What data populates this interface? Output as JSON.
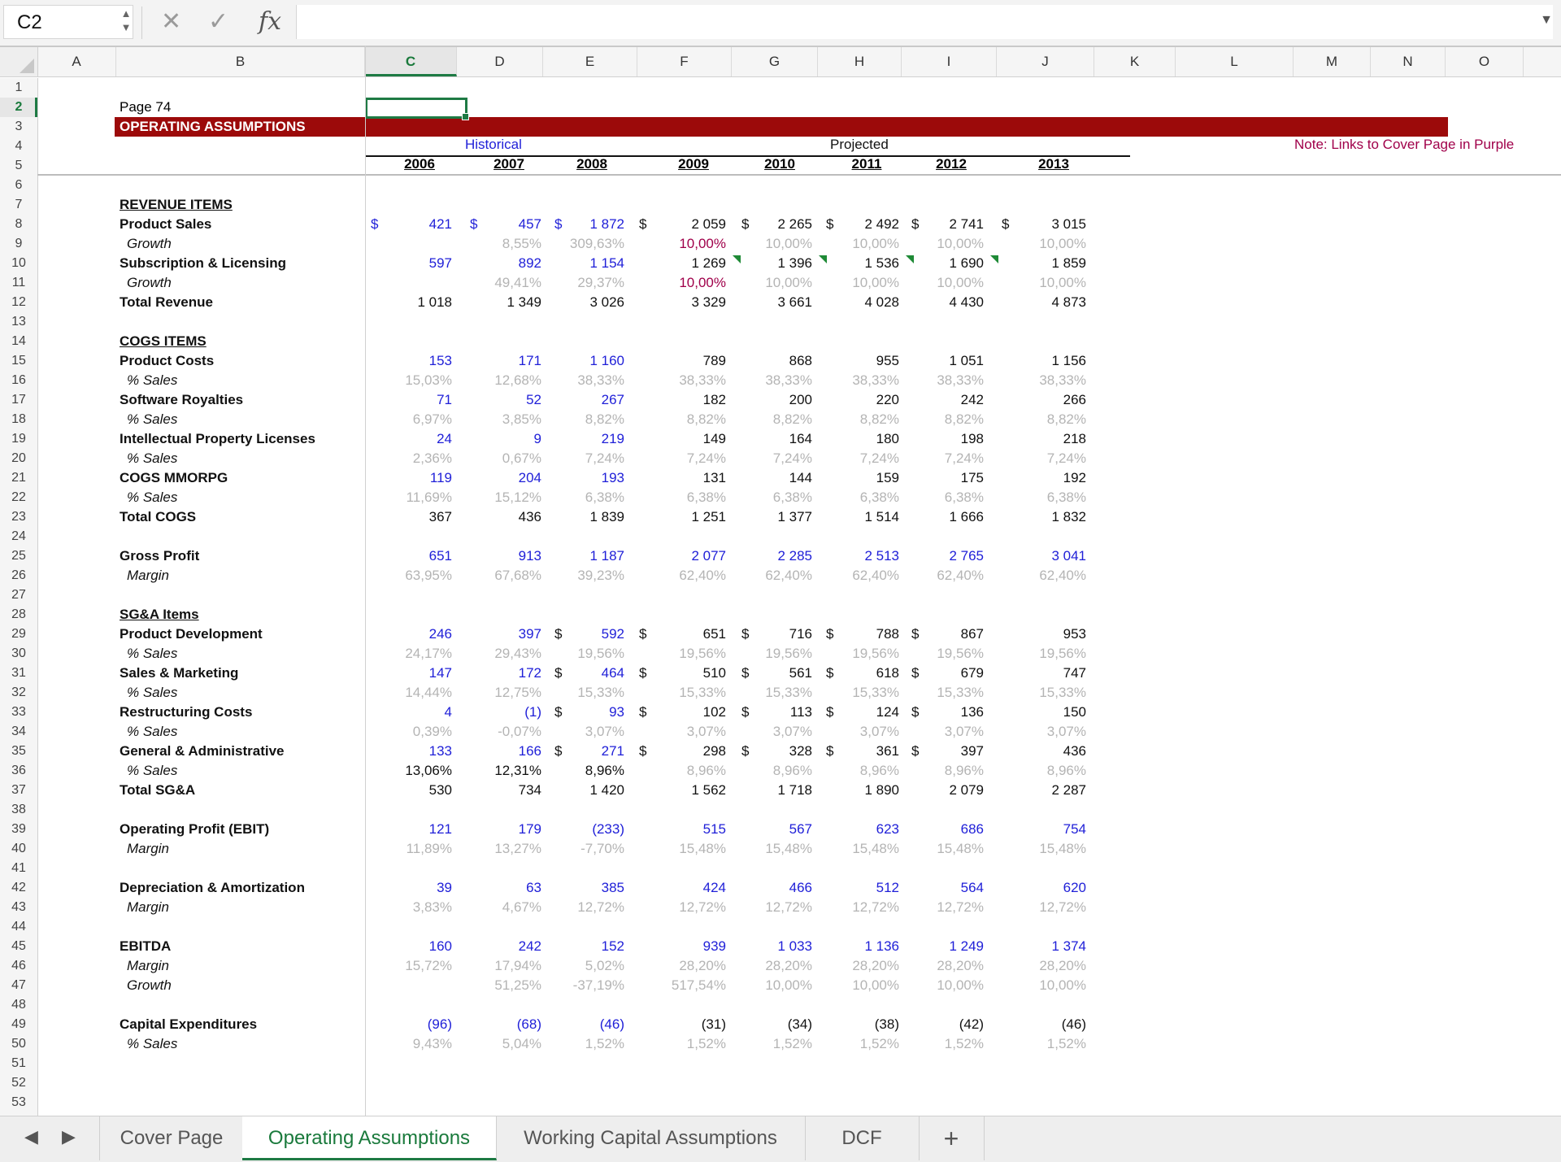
{
  "formula_bar": {
    "name_box": "C2",
    "fx": "fx"
  },
  "columns": [
    "A",
    "B",
    "C",
    "D",
    "E",
    "F",
    "G",
    "H",
    "I",
    "J",
    "K",
    "L",
    "M",
    "N",
    "O"
  ],
  "rows": [
    "1",
    "2",
    "3",
    "4",
    "5",
    "6",
    "7",
    "8",
    "9",
    "10",
    "11",
    "12",
    "13",
    "14",
    "15",
    "16",
    "17",
    "18",
    "19",
    "20",
    "21",
    "22",
    "23",
    "24",
    "25",
    "26",
    "27",
    "28",
    "29",
    "30",
    "31",
    "32",
    "33",
    "34",
    "35",
    "36",
    "37",
    "38",
    "39",
    "40",
    "41",
    "42",
    "43",
    "44",
    "45",
    "46",
    "47",
    "48",
    "49",
    "50",
    "51",
    "52",
    "53"
  ],
  "sheet": {
    "page_label": "Page 74",
    "title": "OPERATING ASSUMPTIONS",
    "historical": "Historical",
    "projected": "Projected",
    "years": [
      "2006",
      "2007",
      "2008",
      "2009",
      "2010",
      "2011",
      "2012",
      "2013"
    ],
    "note": "Note: Links to Cover Page in Purple",
    "dollar": "$",
    "lines": [
      {
        "row": 7,
        "label": "REVENUE ITEMS",
        "style": "bu"
      },
      {
        "row": 8,
        "label": "Product Sales",
        "style": "b",
        "values": [
          "421",
          "457",
          "1 872",
          "2 059",
          "2 265",
          "2 492",
          "2 741",
          "3 015"
        ],
        "colors": [
          "blue",
          "blue",
          "blue",
          "black",
          "black",
          "black",
          "black",
          "black"
        ],
        "dollars": [
          true,
          true,
          true,
          true,
          true,
          true,
          true,
          true
        ]
      },
      {
        "row": 9,
        "label": "Growth",
        "style": "i",
        "values": [
          "",
          "8,55%",
          "309,63%",
          "10,00%",
          "10,00%",
          "10,00%",
          "10,00%",
          "10,00%"
        ],
        "colors": [
          "grey",
          "grey",
          "grey",
          "purple",
          "grey",
          "grey",
          "grey",
          "grey"
        ]
      },
      {
        "row": 10,
        "label": "Subscription & Licensing",
        "style": "b",
        "values": [
          "597",
          "892",
          "1 154",
          "1 269",
          "1 396",
          "1 536",
          "1 690",
          "1 859"
        ],
        "colors": [
          "blue",
          "blue",
          "blue",
          "black",
          "black",
          "black",
          "black",
          "black"
        ],
        "marks": [
          false,
          false,
          false,
          true,
          true,
          true,
          true,
          false
        ]
      },
      {
        "row": 11,
        "label": "Growth",
        "style": "i",
        "values": [
          "",
          "49,41%",
          "29,37%",
          "10,00%",
          "10,00%",
          "10,00%",
          "10,00%",
          "10,00%"
        ],
        "colors": [
          "grey",
          "grey",
          "grey",
          "purple",
          "grey",
          "grey",
          "grey",
          "grey"
        ]
      },
      {
        "row": 12,
        "label": "Total Revenue",
        "style": "b",
        "values": [
          "1 018",
          "1 349",
          "3 026",
          "3 329",
          "3 661",
          "4 028",
          "4 430",
          "4 873"
        ],
        "colors": [
          "black",
          "black",
          "black",
          "black",
          "black",
          "black",
          "black",
          "black"
        ]
      },
      {
        "row": 14,
        "label": "COGS ITEMS",
        "style": "bu"
      },
      {
        "row": 15,
        "label": "Product Costs",
        "style": "b",
        "values": [
          "153",
          "171",
          "1 160",
          "789",
          "868",
          "955",
          "1 051",
          "1 156"
        ],
        "colors": [
          "blue",
          "blue",
          "blue",
          "black",
          "black",
          "black",
          "black",
          "black"
        ]
      },
      {
        "row": 16,
        "label": "% Sales",
        "style": "i",
        "values": [
          "15,03%",
          "12,68%",
          "38,33%",
          "38,33%",
          "38,33%",
          "38,33%",
          "38,33%",
          "38,33%"
        ],
        "colors": [
          "grey",
          "grey",
          "grey",
          "grey",
          "grey",
          "grey",
          "grey",
          "grey"
        ]
      },
      {
        "row": 17,
        "label": "Software Royalties",
        "style": "b",
        "values": [
          "71",
          "52",
          "267",
          "182",
          "200",
          "220",
          "242",
          "266"
        ],
        "colors": [
          "blue",
          "blue",
          "blue",
          "black",
          "black",
          "black",
          "black",
          "black"
        ]
      },
      {
        "row": 18,
        "label": "% Sales",
        "style": "i",
        "values": [
          "6,97%",
          "3,85%",
          "8,82%",
          "8,82%",
          "8,82%",
          "8,82%",
          "8,82%",
          "8,82%"
        ],
        "colors": [
          "grey",
          "grey",
          "grey",
          "grey",
          "grey",
          "grey",
          "grey",
          "grey"
        ]
      },
      {
        "row": 19,
        "label": "Intellectual Property Licenses",
        "style": "b",
        "values": [
          "24",
          "9",
          "219",
          "149",
          "164",
          "180",
          "198",
          "218"
        ],
        "colors": [
          "blue",
          "blue",
          "blue",
          "black",
          "black",
          "black",
          "black",
          "black"
        ]
      },
      {
        "row": 20,
        "label": "% Sales",
        "style": "i",
        "values": [
          "2,36%",
          "0,67%",
          "7,24%",
          "7,24%",
          "7,24%",
          "7,24%",
          "7,24%",
          "7,24%"
        ],
        "colors": [
          "grey",
          "grey",
          "grey",
          "grey",
          "grey",
          "grey",
          "grey",
          "grey"
        ]
      },
      {
        "row": 21,
        "label": "COGS MMORPG",
        "style": "b",
        "values": [
          "119",
          "204",
          "193",
          "131",
          "144",
          "159",
          "175",
          "192"
        ],
        "colors": [
          "blue",
          "blue",
          "blue",
          "black",
          "black",
          "black",
          "black",
          "black"
        ]
      },
      {
        "row": 22,
        "label": "% Sales",
        "style": "i",
        "values": [
          "11,69%",
          "15,12%",
          "6,38%",
          "6,38%",
          "6,38%",
          "6,38%",
          "6,38%",
          "6,38%"
        ],
        "colors": [
          "grey",
          "grey",
          "grey",
          "grey",
          "grey",
          "grey",
          "grey",
          "grey"
        ]
      },
      {
        "row": 23,
        "label": "Total COGS",
        "style": "b",
        "values": [
          "367",
          "436",
          "1 839",
          "1 251",
          "1 377",
          "1 514",
          "1 666",
          "1 832"
        ],
        "colors": [
          "black",
          "black",
          "black",
          "black",
          "black",
          "black",
          "black",
          "black"
        ]
      },
      {
        "row": 25,
        "label": "Gross Profit",
        "style": "b",
        "values": [
          "651",
          "913",
          "1 187",
          "2 077",
          "2 285",
          "2 513",
          "2 765",
          "3 041"
        ],
        "colors": [
          "blue",
          "blue",
          "blue",
          "blue",
          "blue",
          "blue",
          "blue",
          "blue"
        ]
      },
      {
        "row": 26,
        "label": "Margin",
        "style": "i",
        "values": [
          "63,95%",
          "67,68%",
          "39,23%",
          "62,40%",
          "62,40%",
          "62,40%",
          "62,40%",
          "62,40%"
        ],
        "colors": [
          "grey",
          "grey",
          "grey",
          "grey",
          "grey",
          "grey",
          "grey",
          "grey"
        ]
      },
      {
        "row": 28,
        "label": " SG&A Items",
        "style": "bu"
      },
      {
        "row": 29,
        "label": "Product Development",
        "style": "b",
        "values": [
          "246",
          "397",
          "592",
          "651",
          "716",
          "788",
          "867",
          "953"
        ],
        "colors": [
          "blue",
          "blue",
          "blue",
          "black",
          "black",
          "black",
          "black",
          "black"
        ],
        "dollars": [
          false,
          false,
          true,
          true,
          true,
          true,
          true,
          false
        ]
      },
      {
        "row": 30,
        "label": "% Sales",
        "style": "i",
        "values": [
          "24,17%",
          "29,43%",
          "19,56%",
          "19,56%",
          "19,56%",
          "19,56%",
          "19,56%",
          "19,56%"
        ],
        "colors": [
          "grey",
          "grey",
          "grey",
          "grey",
          "grey",
          "grey",
          "grey",
          "grey"
        ]
      },
      {
        "row": 31,
        "label": "Sales & Marketing",
        "style": "b",
        "values": [
          "147",
          "172",
          "464",
          "510",
          "561",
          "618",
          "679",
          "747"
        ],
        "colors": [
          "blue",
          "blue",
          "blue",
          "black",
          "black",
          "black",
          "black",
          "black"
        ],
        "dollars": [
          false,
          false,
          true,
          true,
          true,
          true,
          true,
          false
        ]
      },
      {
        "row": 32,
        "label": "% Sales",
        "style": "i",
        "values": [
          "14,44%",
          "12,75%",
          "15,33%",
          "15,33%",
          "15,33%",
          "15,33%",
          "15,33%",
          "15,33%"
        ],
        "colors": [
          "grey",
          "grey",
          "grey",
          "grey",
          "grey",
          "grey",
          "grey",
          "grey"
        ]
      },
      {
        "row": 33,
        "label": "Restructuring Costs",
        "style": "b",
        "values": [
          "4",
          "(1)",
          "93",
          "102",
          "113",
          "124",
          "136",
          "150"
        ],
        "colors": [
          "blue",
          "blue",
          "blue",
          "black",
          "black",
          "black",
          "black",
          "black"
        ],
        "dollars": [
          false,
          false,
          true,
          true,
          true,
          true,
          true,
          false
        ]
      },
      {
        "row": 34,
        "label": "% Sales",
        "style": "i",
        "values": [
          "0,39%",
          "-0,07%",
          "3,07%",
          "3,07%",
          "3,07%",
          "3,07%",
          "3,07%",
          "3,07%"
        ],
        "colors": [
          "grey",
          "grey",
          "grey",
          "grey",
          "grey",
          "grey",
          "grey",
          "grey"
        ]
      },
      {
        "row": 35,
        "label": "General & Administrative",
        "style": "b",
        "values": [
          "133",
          "166",
          "271",
          "298",
          "328",
          "361",
          "397",
          "436"
        ],
        "colors": [
          "blue",
          "blue",
          "blue",
          "black",
          "black",
          "black",
          "black",
          "black"
        ],
        "dollars": [
          false,
          false,
          true,
          true,
          true,
          true,
          true,
          false
        ]
      },
      {
        "row": 36,
        "label": "% Sales",
        "style": "i",
        "values": [
          "13,06%",
          "12,31%",
          "8,96%",
          "8,96%",
          "8,96%",
          "8,96%",
          "8,96%",
          "8,96%"
        ],
        "colors": [
          "black",
          "black",
          "black",
          "grey",
          "grey",
          "grey",
          "grey",
          "grey"
        ]
      },
      {
        "row": 37,
        "label": "Total SG&A",
        "style": "b",
        "values": [
          "530",
          "734",
          "1 420",
          "1 562",
          "1 718",
          "1 890",
          "2 079",
          "2 287"
        ],
        "colors": [
          "black",
          "black",
          "black",
          "black",
          "black",
          "black",
          "black",
          "black"
        ]
      },
      {
        "row": 39,
        "label": "Operating Profit (EBIT)",
        "style": "b",
        "values": [
          "121",
          "179",
          "(233)",
          "515",
          "567",
          "623",
          "686",
          "754"
        ],
        "colors": [
          "blue",
          "blue",
          "blue",
          "blue",
          "blue",
          "blue",
          "blue",
          "blue"
        ]
      },
      {
        "row": 40,
        "label": "Margin",
        "style": "i",
        "values": [
          "11,89%",
          "13,27%",
          "-7,70%",
          "15,48%",
          "15,48%",
          "15,48%",
          "15,48%",
          "15,48%"
        ],
        "colors": [
          "grey",
          "grey",
          "grey",
          "grey",
          "grey",
          "grey",
          "grey",
          "grey"
        ]
      },
      {
        "row": 42,
        "label": "Depreciation & Amortization",
        "style": "b",
        "values": [
          "39",
          "63",
          "385",
          "424",
          "466",
          "512",
          "564",
          "620"
        ],
        "colors": [
          "blue",
          "blue",
          "blue",
          "blue",
          "blue",
          "blue",
          "blue",
          "blue"
        ]
      },
      {
        "row": 43,
        "label": "Margin",
        "style": "i",
        "values": [
          "3,83%",
          "4,67%",
          "12,72%",
          "12,72%",
          "12,72%",
          "12,72%",
          "12,72%",
          "12,72%"
        ],
        "colors": [
          "grey",
          "grey",
          "grey",
          "grey",
          "grey",
          "grey",
          "grey",
          "grey"
        ]
      },
      {
        "row": 45,
        "label": "EBITDA",
        "style": "b",
        "values": [
          "160",
          "242",
          "152",
          "939",
          "1 033",
          "1 136",
          "1 249",
          "1 374"
        ],
        "colors": [
          "blue",
          "blue",
          "blue",
          "blue",
          "blue",
          "blue",
          "blue",
          "blue"
        ]
      },
      {
        "row": 46,
        "label": "Margin",
        "style": "i",
        "values": [
          "15,72%",
          "17,94%",
          "5,02%",
          "28,20%",
          "28,20%",
          "28,20%",
          "28,20%",
          "28,20%"
        ],
        "colors": [
          "grey",
          "grey",
          "grey",
          "grey",
          "grey",
          "grey",
          "grey",
          "grey"
        ]
      },
      {
        "row": 47,
        "label": "Growth",
        "style": "i",
        "values": [
          "",
          "51,25%",
          "-37,19%",
          "517,54%",
          "10,00%",
          "10,00%",
          "10,00%",
          "10,00%"
        ],
        "colors": [
          "grey",
          "grey",
          "grey",
          "grey",
          "grey",
          "grey",
          "grey",
          "grey"
        ]
      },
      {
        "row": 49,
        "label": "Capital Expenditures",
        "style": "b",
        "values": [
          "(96)",
          "(68)",
          "(46)",
          "(31)",
          "(34)",
          "(38)",
          "(42)",
          "(46)"
        ],
        "colors": [
          "blue",
          "blue",
          "blue",
          "black",
          "black",
          "black",
          "black",
          "black"
        ]
      },
      {
        "row": 50,
        "label": "% Sales",
        "style": "i",
        "values": [
          "9,43%",
          "5,04%",
          "1,52%",
          "1,52%",
          "1,52%",
          "1,52%",
          "1,52%",
          "1,52%"
        ],
        "colors": [
          "grey",
          "grey",
          "grey",
          "grey",
          "grey",
          "grey",
          "grey",
          "grey"
        ]
      }
    ]
  },
  "tabs": [
    "Cover Page",
    "Operating Assumptions",
    "Working Capital Assumptions",
    "DCF"
  ],
  "active_tab": "Operating Assumptions",
  "add_tab": "+"
}
